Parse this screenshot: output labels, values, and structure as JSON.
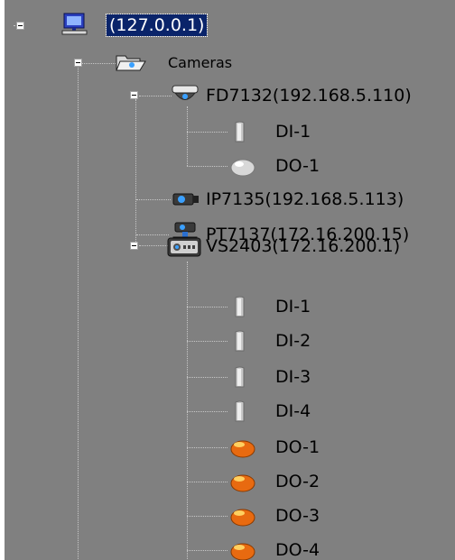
{
  "tree": {
    "server": {
      "label": "(127.0.0.1)",
      "icon": "computer-icon",
      "expanded": true,
      "selected": true
    },
    "cameras": {
      "label": "Cameras",
      "icon": "open-folder-icon",
      "expanded": true
    },
    "devices": [
      {
        "label": "FD7132(192.168.5.110)",
        "icon": "dome-camera-icon",
        "expanded": true,
        "children": [
          {
            "label": "DI-1",
            "icon": "digital-input-icon"
          },
          {
            "label": "DO-1",
            "icon": "digital-output-off-icon"
          }
        ]
      },
      {
        "label": "IP7135(192.168.5.113)",
        "icon": "box-camera-icon"
      },
      {
        "label": "PT7137(172.16.200.15)",
        "icon": "ptz-camera-icon"
      },
      {
        "label": "VS2403(172.16.200.1)",
        "icon": "video-server-icon",
        "expanded": true,
        "children": [
          {
            "label": "DI-1",
            "icon": "digital-input-icon"
          },
          {
            "label": "DI-2",
            "icon": "digital-input-icon"
          },
          {
            "label": "DI-3",
            "icon": "digital-input-icon"
          },
          {
            "label": "DI-4",
            "icon": "digital-input-icon"
          },
          {
            "label": "DO-1",
            "icon": "digital-output-on-icon"
          },
          {
            "label": "DO-2",
            "icon": "digital-output-on-icon"
          },
          {
            "label": "DO-3",
            "icon": "digital-output-on-icon"
          },
          {
            "label": "DO-4",
            "icon": "digital-output-on-icon"
          }
        ]
      }
    ]
  },
  "colors": {
    "background": "#808080",
    "selection": "#0a246a",
    "output_on": "#e86a10",
    "output_off": "#d8d8d8"
  }
}
